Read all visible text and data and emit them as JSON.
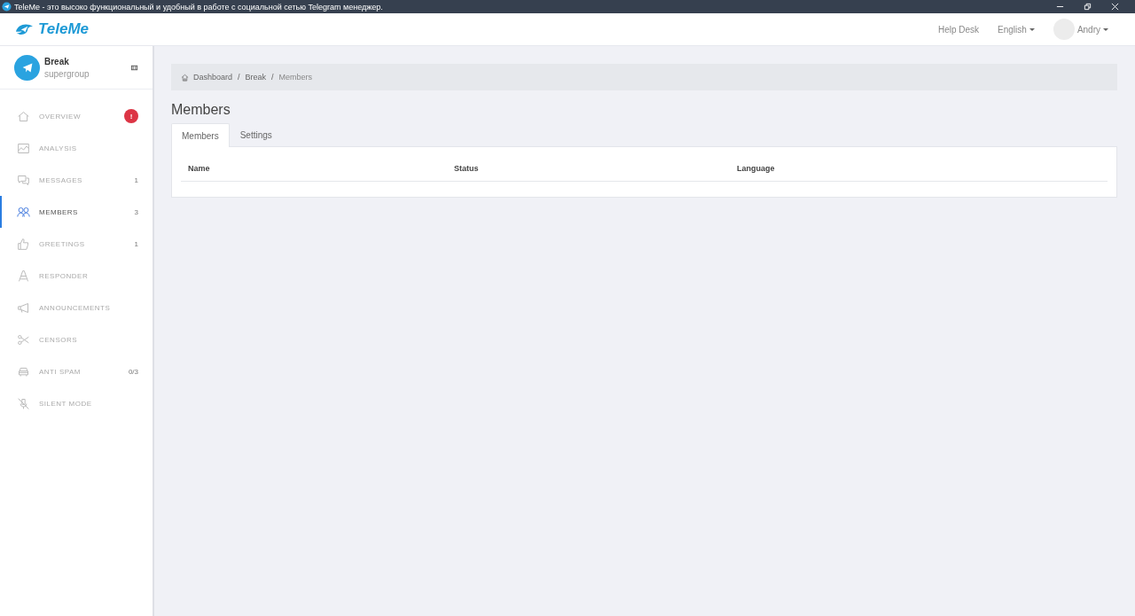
{
  "window": {
    "title": "TeleMe - это высоко функциональный и удобный в работе с социальной сетью Telegram менеджер."
  },
  "header": {
    "logo": "TeleMe",
    "links": [
      "Help Desk"
    ],
    "language": "English",
    "user": "Andry"
  },
  "group": {
    "name": "Break",
    "type": "supergroup"
  },
  "sidebar": {
    "items": [
      {
        "label": "OVERVIEW",
        "selected": false,
        "badge": {
          "text": "!",
          "alert": true
        }
      },
      {
        "label": "ANALYSIS",
        "selected": false
      },
      {
        "label": "MESSAGES",
        "selected": false,
        "badge": {
          "text": "1",
          "alert": false
        }
      },
      {
        "label": "MEMBERS",
        "selected": true,
        "badge": {
          "text": "3",
          "alert": false
        }
      },
      {
        "label": "GREETINGS",
        "selected": false,
        "badge": {
          "text": "1",
          "alert": false
        }
      },
      {
        "label": "RESPONDER",
        "selected": false
      },
      {
        "label": "ANNOUNCEMENTS",
        "selected": false
      },
      {
        "label": "CENSORS",
        "selected": false
      },
      {
        "label": "ANTI SPAM",
        "selected": false,
        "badge": {
          "text": "0/3",
          "alert": false
        }
      },
      {
        "label": "SILENT MODE",
        "selected": false
      }
    ]
  },
  "breadcrumb": {
    "separator": "/",
    "items": [
      "Dashboard",
      "Break",
      "Members"
    ]
  },
  "page": {
    "title": "Members"
  },
  "tabs": [
    {
      "label": "Members",
      "selected": true
    },
    {
      "label": "Settings",
      "selected": false
    }
  ],
  "table": {
    "columns": [
      "Name",
      "Status",
      "Language"
    ]
  }
}
